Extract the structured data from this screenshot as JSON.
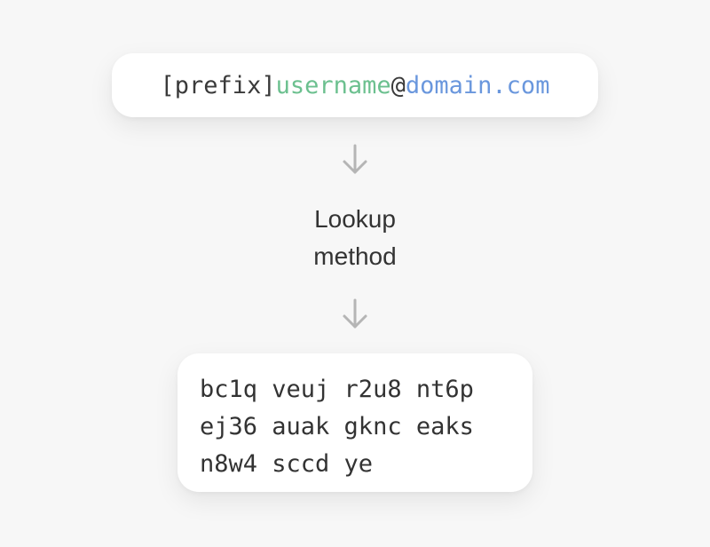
{
  "address": {
    "prefix": "[prefix]",
    "username": "username",
    "at": "@",
    "domain": "domain.com"
  },
  "method": {
    "line1": "Lookup",
    "line2": "method"
  },
  "result": {
    "lines": [
      "bc1q veuj r2u8 nt6p",
      "ej36 auak gknc eaks",
      "n8w4 sccd ye"
    ]
  },
  "colors": {
    "background": "#f7f7f7",
    "card": "#ffffff",
    "username": "#6cc08f",
    "domain": "#6a97dd",
    "text": "#3a3a3a",
    "arrow": "#b5b5b5"
  },
  "icons": [
    "arrow-down-icon",
    "arrow-down-icon"
  ]
}
